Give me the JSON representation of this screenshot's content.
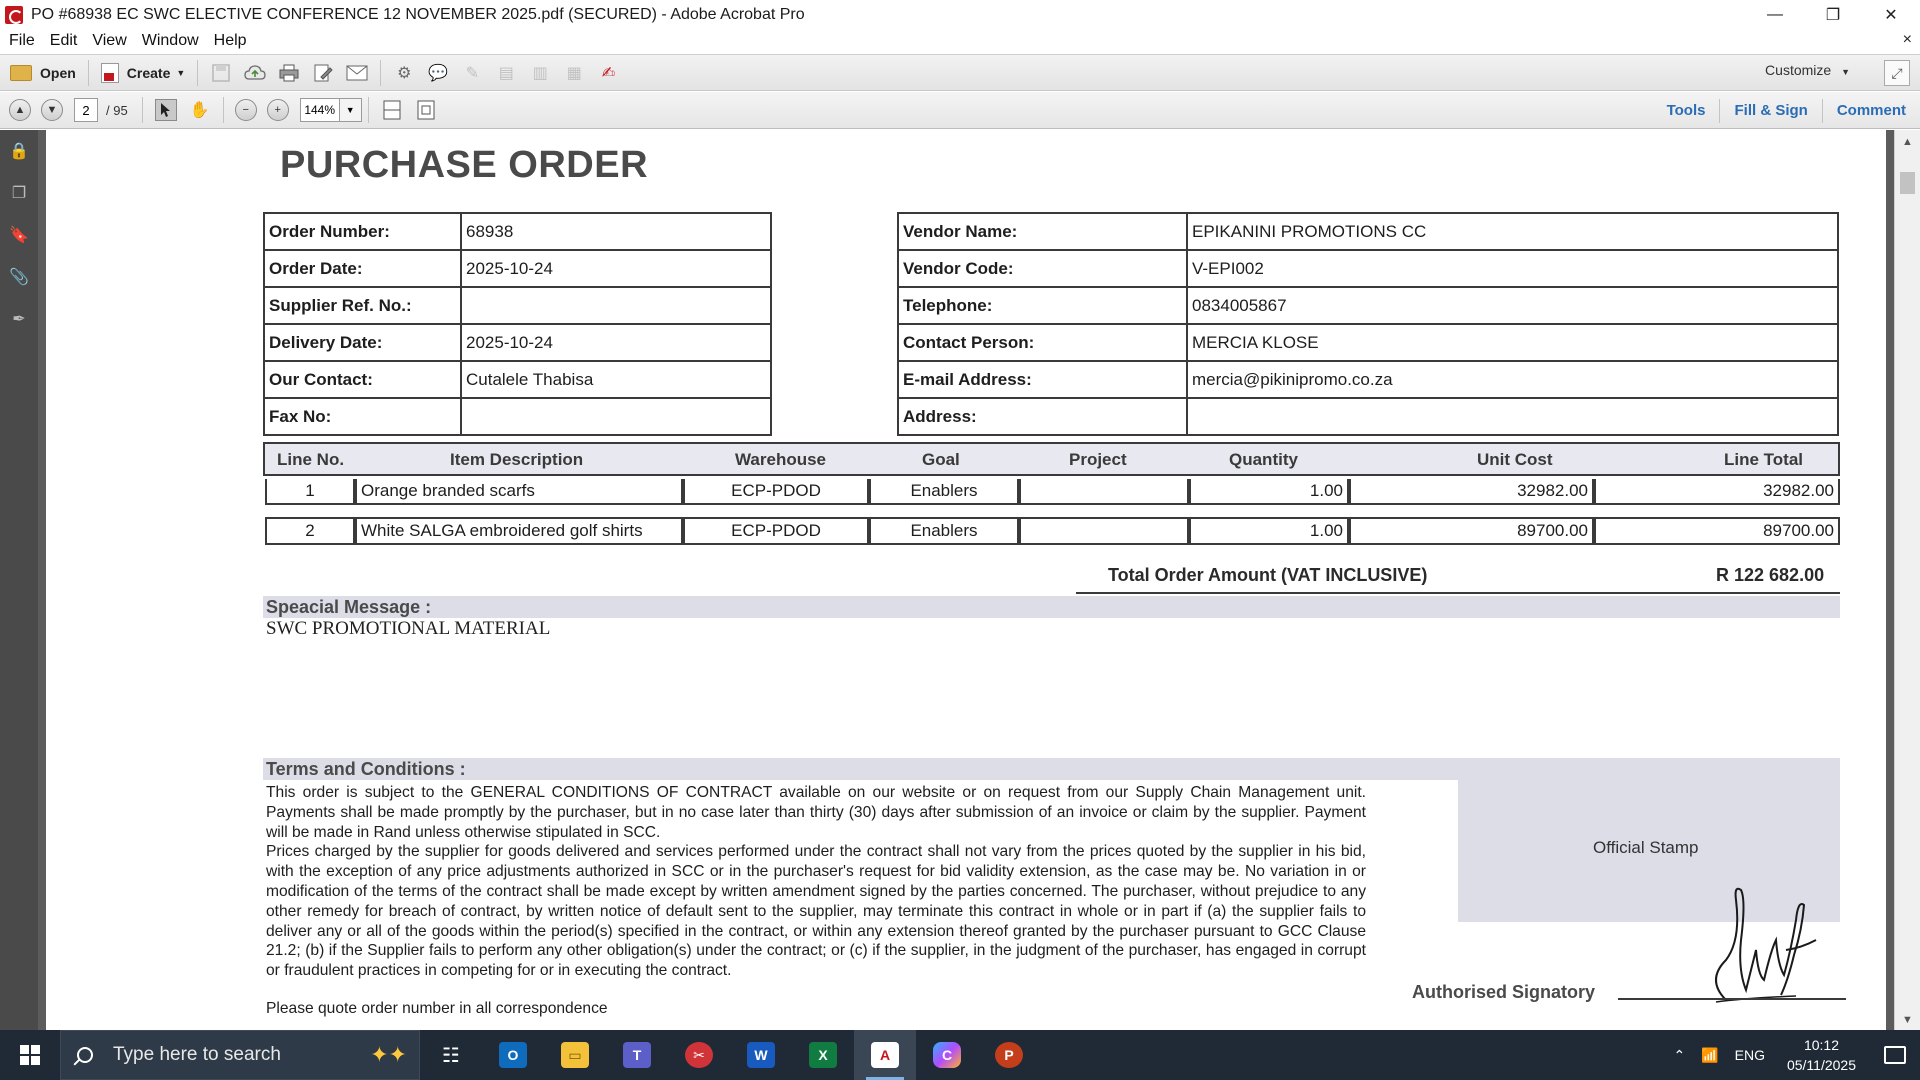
{
  "window": {
    "title": "PO #68938 EC SWC ELECTIVE CONFERENCE 12 NOVEMBER 2025.pdf (SECURED) - Adobe Acrobat Pro",
    "controls": {
      "minimize": "—",
      "restore": "❐",
      "close": "✕"
    }
  },
  "menu": {
    "items": [
      "File",
      "Edit",
      "View",
      "Window",
      "Help"
    ],
    "close_doc": "×"
  },
  "toolbar": {
    "open_label": "Open",
    "create_label": "Create",
    "customize_label": "Customize"
  },
  "nav": {
    "current_page": "2",
    "total_pages": "/ 95",
    "zoom": "144%",
    "links": {
      "tools": "Tools",
      "fill_sign": "Fill & Sign",
      "comment": "Comment"
    }
  },
  "document": {
    "title": "PURCHASE ORDER",
    "order_info": [
      {
        "label": "Order Number:",
        "value": "68938"
      },
      {
        "label": "Order Date:",
        "value": "2025-10-24"
      },
      {
        "label": "Supplier Ref. No.:",
        "value": ""
      },
      {
        "label": "Delivery Date:",
        "value": "2025-10-24"
      },
      {
        "label": "Our Contact:",
        "value": "Cutalele Thabisa"
      },
      {
        "label": "Fax No:",
        "value": ""
      }
    ],
    "vendor_info": [
      {
        "label": "Vendor Name:",
        "value": "EPIKANINI PROMOTIONS CC"
      },
      {
        "label": "Vendor Code:",
        "value": "V-EPI002"
      },
      {
        "label": "Telephone:",
        "value": "0834005867"
      },
      {
        "label": "Contact Person:",
        "value": "MERCIA KLOSE"
      },
      {
        "label": "E-mail Address:",
        "value": "mercia@pikinipromo.co.za"
      },
      {
        "label": "Address:",
        "value": ""
      }
    ],
    "line_headers": {
      "line_no": "Line No.",
      "item_description": "Item Description",
      "warehouse": "Warehouse",
      "goal": "Goal",
      "project": "Project",
      "quantity": "Quantity",
      "unit_cost": "Unit Cost",
      "line_total": "Line Total"
    },
    "lines": [
      {
        "line_no": "1",
        "description": "Orange branded scarfs",
        "warehouse": "ECP-PDOD",
        "goal": "Enablers",
        "project": "",
        "quantity": "1.00",
        "unit_cost": "32982.00",
        "line_total": "32982.00"
      },
      {
        "line_no": "2",
        "description": "White SALGA embroidered golf shirts",
        "warehouse": "ECP-PDOD",
        "goal": "Enablers",
        "project": "",
        "quantity": "1.00",
        "unit_cost": "89700.00",
        "line_total": "89700.00"
      }
    ],
    "total_label": "Total Order Amount (VAT INCLUSIVE)",
    "total_value": "R 122 682.00",
    "special_message_label": "Speacial Message :",
    "special_message": "SWC PROMOTIONAL MATERIAL",
    "terms_label": "Terms and Conditions :",
    "terms_p1": "This order is subject to the GENERAL CONDITIONS OF CONTRACT available on our website or on request from our Supply Chain Management unit. Payments shall be made promptly by the purchaser, but in no case later than thirty (30) days after submission of an invoice or claim by the supplier. Payment will be made in Rand unless otherwise stipulated in SCC.",
    "terms_p2": "Prices charged by the supplier for goods delivered and services performed under the contract shall not vary from the prices quoted by the supplier in his bid, with the exception of any price adjustments authorized in SCC or in the purchaser's request for bid validity extension, as the case may be. No variation in or modification of the terms of the contract shall be made except by written amendment signed by the parties concerned. The purchaser, without prejudice to any other remedy for breach of contract, by written notice of default sent to the supplier, may terminate this contract in whole or in part if (a) the supplier fails to deliver any or all of the goods within the period(s) specified in the contract, or within any extension thereof granted by the purchaser pursuant to GCC Clause 21.2; (b) if the Supplier fails to perform any other obligation(s) under the contract; or (c) if the supplier, in the judgment of the purchaser, has engaged in corrupt or fraudulent practices in competing for or in executing the contract.",
    "quote_note": "Please quote order number in all correspondence",
    "official_stamp": "Official Stamp",
    "authorised_signatory": "Authorised Signatory"
  },
  "taskbar": {
    "search_placeholder": "Type here to search",
    "language": "ENG",
    "time": "10:12",
    "date": "05/11/2025"
  },
  "colors": {
    "acrobat_red": "#c4171c",
    "link_blue": "#2a6db5",
    "taskbar": "#1f2a36"
  }
}
